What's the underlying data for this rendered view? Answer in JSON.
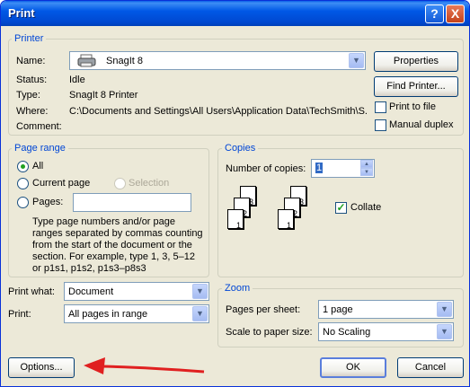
{
  "window": {
    "title": "Print",
    "help_label": "?",
    "close_label": "X"
  },
  "printer": {
    "legend": "Printer",
    "name_label": "Name:",
    "name_value": "SnagIt 8",
    "status_label": "Status:",
    "status_value": "Idle",
    "type_label": "Type:",
    "type_value": "SnagIt 8 Printer",
    "where_label": "Where:",
    "where_value": "C:\\Documents and Settings\\All Users\\Application Data\\TechSmith\\S...",
    "comment_label": "Comment:",
    "properties_label": "Properties",
    "find_printer_label": "Find Printer...",
    "print_to_file_label": "Print to file",
    "manual_duplex_label": "Manual duplex"
  },
  "page_range": {
    "legend": "Page range",
    "all_label": "All",
    "current_page_label": "Current page",
    "selection_label": "Selection",
    "pages_label": "Pages:",
    "pages_value": "",
    "help_text": "Type page numbers and/or page ranges separated by commas counting from the start of the document or the section. For example, type 1, 3, 5–12 or p1s1, p1s2, p1s3–p8s3",
    "selected": "All"
  },
  "copies": {
    "legend": "Copies",
    "number_label": "Number of copies:",
    "number_value": "1",
    "collate_label": "Collate",
    "collate_checked": true,
    "page_numbers": [
      "1",
      "2",
      "3"
    ]
  },
  "print_what": {
    "label": "Print what:",
    "value": "Document"
  },
  "print": {
    "label": "Print:",
    "value": "All pages in range"
  },
  "zoom": {
    "legend": "Zoom",
    "pages_per_sheet_label": "Pages per sheet:",
    "pages_per_sheet_value": "1 page",
    "scale_label": "Scale to paper size:",
    "scale_value": "No Scaling"
  },
  "buttons": {
    "options": "Options...",
    "ok": "OK",
    "cancel": "Cancel"
  },
  "icons": {
    "printer": "printer-icon",
    "dropdown": "chevron-down-icon",
    "annotation": "red-arrow"
  },
  "colors": {
    "title_bar": "#0058e6",
    "legend": "#0046d5",
    "arrow": "#e02020"
  }
}
